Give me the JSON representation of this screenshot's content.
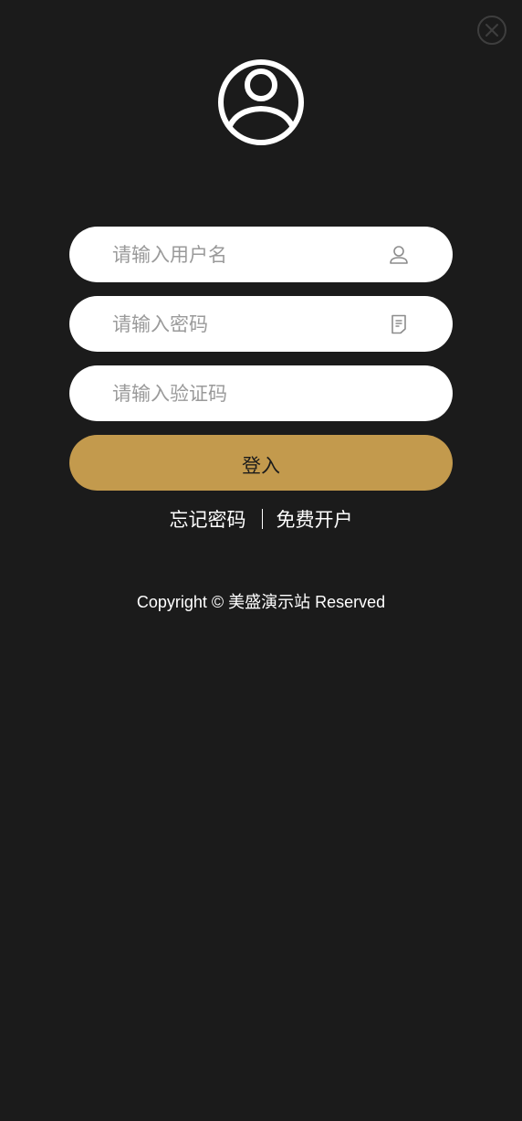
{
  "header": {
    "close_icon": "close-circle-icon",
    "avatar_icon": "user-circle-icon"
  },
  "form": {
    "username": {
      "placeholder": "请输入用户名",
      "value": "",
      "icon": "user-icon"
    },
    "password": {
      "placeholder": "请输入密码",
      "value": "",
      "icon": "document-icon"
    },
    "captcha": {
      "placeholder": "请输入验证码",
      "value": ""
    },
    "login_label": "登入"
  },
  "links": {
    "forgot_password": "忘记密码",
    "separator": "|",
    "register": "免费开户"
  },
  "footer": {
    "copyright": "Copyright © 美盛演示站 Reserved"
  },
  "colors": {
    "background": "#1b1b1b",
    "accent": "#c39a4d",
    "field_bg": "#ffffff",
    "placeholder": "#9a9a9a"
  }
}
